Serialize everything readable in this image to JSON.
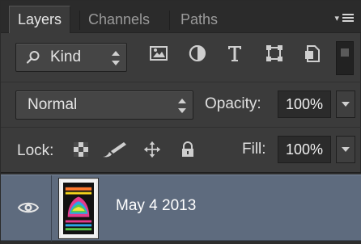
{
  "tabs": [
    {
      "label": "Layers",
      "active": true
    },
    {
      "label": "Channels",
      "active": false
    },
    {
      "label": "Paths",
      "active": false
    }
  ],
  "filter": {
    "kind_label": "Kind",
    "icons": [
      "pixel-layer-filter-icon",
      "adjustment-layer-filter-icon",
      "type-layer-filter-icon",
      "shape-layer-filter-icon",
      "smart-object-filter-icon"
    ]
  },
  "blend": {
    "mode": "Normal",
    "opacity_label": "Opacity:",
    "opacity_value": "100%"
  },
  "lock": {
    "label": "Lock:",
    "icons": [
      "lock-transparent-pixels-icon",
      "lock-image-pixels-icon",
      "lock-position-icon",
      "lock-all-icon"
    ]
  },
  "fill": {
    "label": "Fill:",
    "value": "100%"
  },
  "layers": [
    {
      "name": "May 4 2013",
      "visible": true,
      "selected": true
    }
  ],
  "colors": {
    "panel": "#3b3b3b",
    "tabbar": "#2b2b2b",
    "selected_layer": "#5e6b7e"
  }
}
